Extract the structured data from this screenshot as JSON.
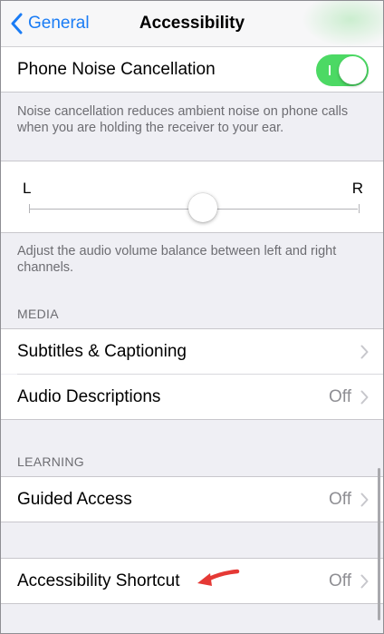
{
  "nav": {
    "back_label": "General",
    "title": "Accessibility"
  },
  "noise": {
    "label": "Phone Noise Cancellation",
    "enabled": true,
    "footer": "Noise cancellation reduces ambient noise on phone calls when you are holding the receiver to your ear."
  },
  "balance": {
    "left_label": "L",
    "right_label": "R",
    "value": 0.5,
    "footer": "Adjust the audio volume balance between left and right channels."
  },
  "media": {
    "header": "MEDIA",
    "items": [
      {
        "label": "Subtitles & Captioning",
        "value": ""
      },
      {
        "label": "Audio Descriptions",
        "value": "Off"
      }
    ]
  },
  "learning": {
    "header": "LEARNING",
    "items": [
      {
        "label": "Guided Access",
        "value": "Off"
      }
    ]
  },
  "shortcut": {
    "label": "Accessibility Shortcut",
    "value": "Off"
  },
  "colors": {
    "accent": "#1a7cf5",
    "toggle_on": "#4cd964",
    "annotation_arrow": "#e53935"
  }
}
